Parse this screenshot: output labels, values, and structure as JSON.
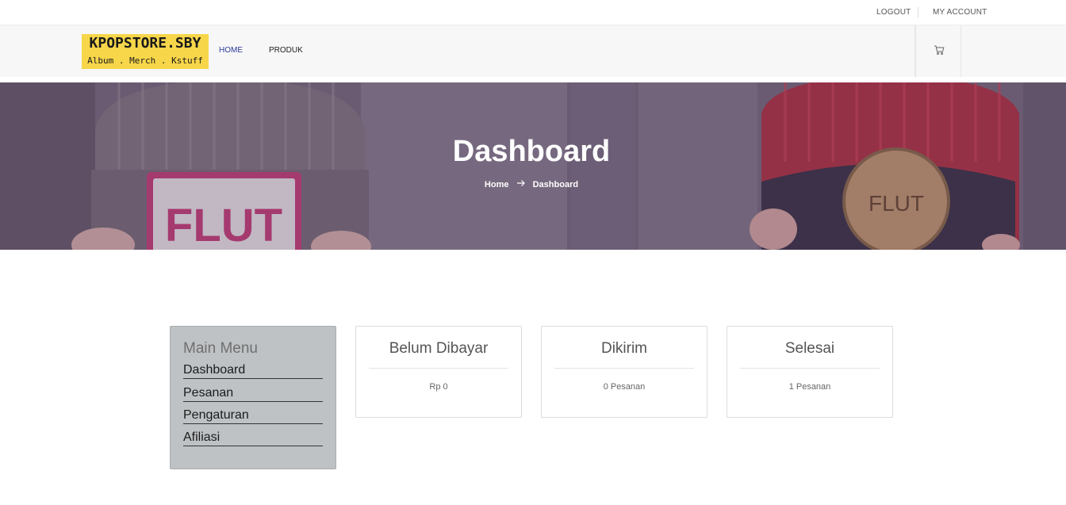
{
  "topbar": {
    "logout": "LOGOUT",
    "account": "MY ACCOUNT"
  },
  "logo": {
    "title": "KPOPSTORE.SBY",
    "subtitle": "Album . Merch . Kstuff"
  },
  "nav": {
    "items": [
      {
        "label": "HOME"
      },
      {
        "label": "PRODUK"
      }
    ],
    "cart_icon": "cart-icon"
  },
  "hero": {
    "title": "Dashboard",
    "breadcrumb": {
      "home": "Home",
      "current": "Dashboard"
    },
    "patch_left": "FLUT",
    "patch_right": "FLUT"
  },
  "menu": {
    "title": "Main Menu",
    "items": [
      {
        "label": "Dashboard"
      },
      {
        "label": "Pesanan"
      },
      {
        "label": "Pengaturan"
      },
      {
        "label": "Afiliasi"
      }
    ]
  },
  "cards": [
    {
      "title": "Belum Dibayar",
      "value": "Rp 0"
    },
    {
      "title": "Dikirim",
      "value": "0 Pesanan"
    },
    {
      "title": "Selesai",
      "value": "1 Pesanan"
    }
  ],
  "colors": {
    "nav_active": "#2b3a9a",
    "logo_bg": "#f7d64a",
    "menu_bg": "#bec2c5"
  }
}
